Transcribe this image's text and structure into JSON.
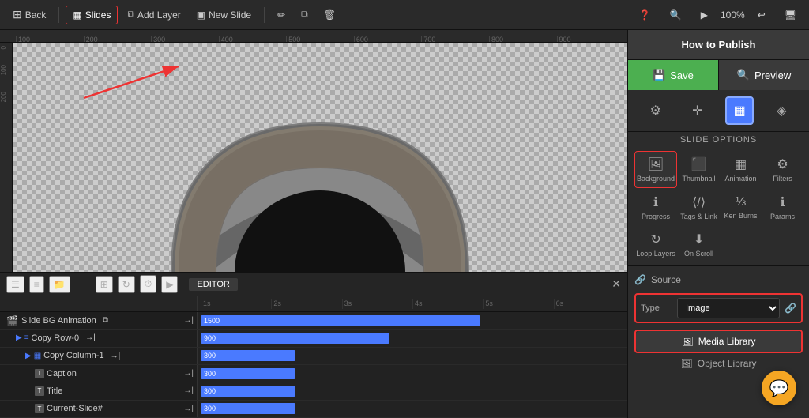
{
  "header": {
    "back_label": "Back",
    "slides_label": "Slides",
    "add_layer_label": "Add Layer",
    "new_slide_label": "New Slide",
    "zoom_label": "100%",
    "title": "How to Publish"
  },
  "right_panel": {
    "save_label": "Save",
    "preview_label": "Preview",
    "slide_options_label": "SLIDE OPTIONS",
    "options": [
      {
        "label": "Background",
        "active": true
      },
      {
        "label": "Thumbnail",
        "active": false
      },
      {
        "label": "Animation",
        "active": false
      },
      {
        "label": "Filters",
        "active": false
      },
      {
        "label": "Progress",
        "active": false
      },
      {
        "label": "Tags & Link",
        "active": false
      },
      {
        "label": "Ken Burns",
        "active": false
      },
      {
        "label": "Params",
        "active": false
      },
      {
        "label": "Loop Layers",
        "active": false
      },
      {
        "label": "On Scroll",
        "active": false
      }
    ],
    "source": {
      "title": "Source",
      "type_label": "Type",
      "type_value": "Image",
      "media_library_label": "Media Library",
      "object_library_label": "Object Library"
    }
  },
  "timeline": {
    "editor_label": "EDITOR",
    "rows": [
      {
        "label": "Slide BG Animation",
        "indent": 0,
        "bar_label": "1500",
        "bar_width_pct": 70,
        "icon": "film"
      },
      {
        "label": "Copy Row-0",
        "indent": 1,
        "bar_label": "900",
        "bar_width_pct": 45,
        "icon": "row"
      },
      {
        "label": "Copy Column-1",
        "indent": 2,
        "bar_label": "300",
        "bar_width_pct": 22,
        "icon": "col"
      },
      {
        "label": "Caption",
        "indent": 3,
        "bar_label": "300",
        "bar_width_pct": 22,
        "icon": "T"
      },
      {
        "label": "Title",
        "indent": 3,
        "bar_label": "300",
        "bar_width_pct": 22,
        "icon": "T"
      },
      {
        "label": "Current-Slide#",
        "indent": 3,
        "bar_label": "300",
        "bar_width_pct": 22,
        "icon": "T"
      }
    ],
    "time_ticks": [
      "1s",
      "2s",
      "3s",
      "4s",
      "5s",
      "6s"
    ]
  }
}
